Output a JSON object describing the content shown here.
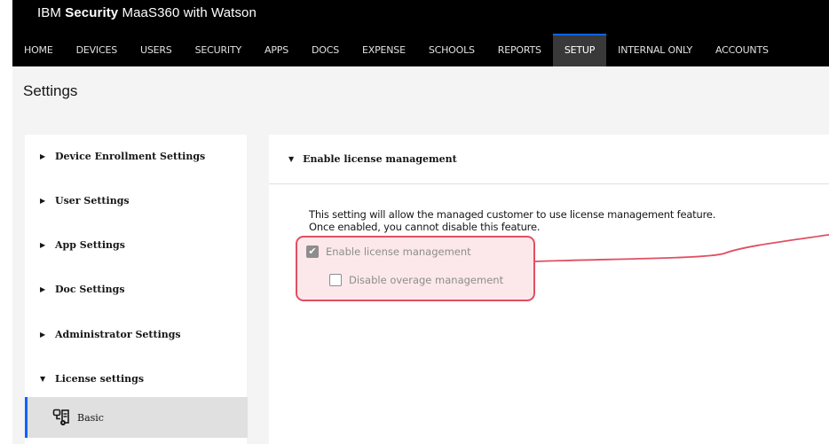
{
  "brand": {
    "prefix": "IBM ",
    "bold": "Security",
    "suffix": " MaaS360 with Watson"
  },
  "nav": [
    {
      "label": "HOME"
    },
    {
      "label": "DEVICES"
    },
    {
      "label": "USERS"
    },
    {
      "label": "SECURITY"
    },
    {
      "label": "APPS"
    },
    {
      "label": "DOCS"
    },
    {
      "label": "EXPENSE"
    },
    {
      "label": "SCHOOLS"
    },
    {
      "label": "REPORTS"
    },
    {
      "label": "SETUP",
      "active": true
    },
    {
      "label": "INTERNAL ONLY"
    },
    {
      "label": "ACCOUNTS"
    }
  ],
  "page": {
    "title": "Settings"
  },
  "sidebar": {
    "items": [
      {
        "label": "Device Enrollment Settings",
        "expanded": false
      },
      {
        "label": "User Settings",
        "expanded": false
      },
      {
        "label": "App Settings",
        "expanded": false
      },
      {
        "label": "Doc Settings",
        "expanded": false
      },
      {
        "label": "Administrator Settings",
        "expanded": false
      },
      {
        "label": "License settings",
        "expanded": true
      }
    ],
    "sub_item": {
      "label": "Basic",
      "icon": "license-badge-icon"
    }
  },
  "section": {
    "title": "Enable license management",
    "description_line1": "This setting will allow the managed customer to use license management feature.",
    "description_line2": "Once enabled, you cannot disable this feature.",
    "checkbox_enable": {
      "label": "Enable license management",
      "checked": true,
      "disabled": true
    },
    "checkbox_overage": {
      "label": "Disable overage management",
      "checked": false,
      "disabled": true
    }
  },
  "colors": {
    "accent": "#0f62fe",
    "highlight": "#e04f63",
    "topbar": "#000000",
    "nav_active": "#393939"
  }
}
